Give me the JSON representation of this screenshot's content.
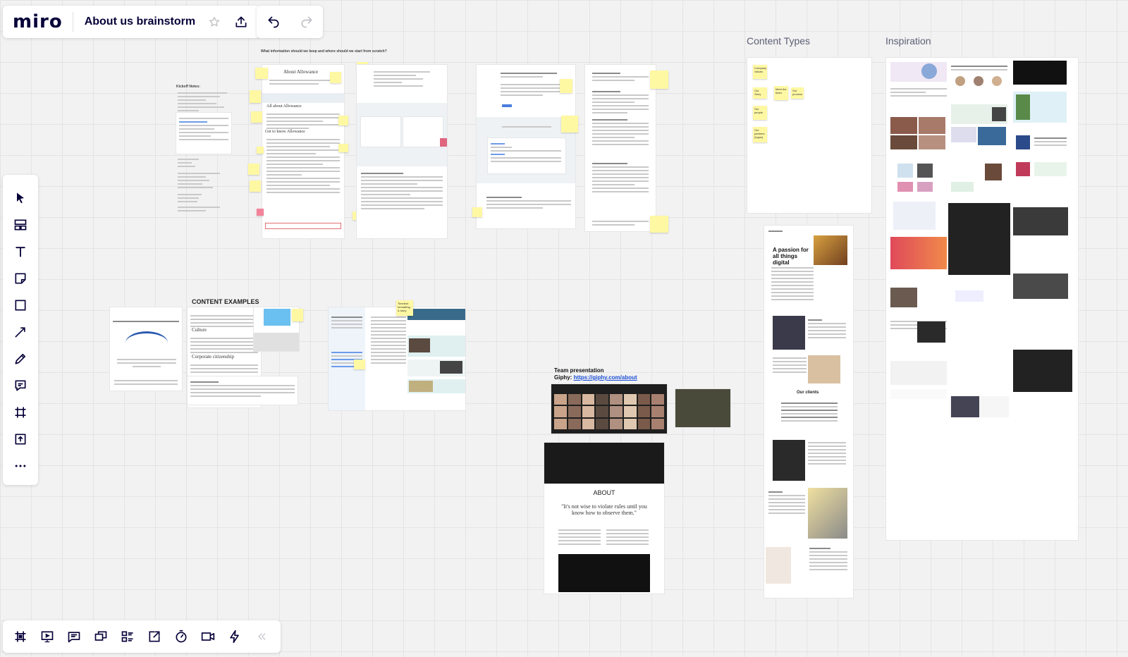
{
  "app": {
    "logo": "miro",
    "board_title": "About us brainstorm"
  },
  "topbar": {
    "star_icon": "star-icon",
    "share_icon": "upload-icon",
    "undo_icon": "undo-icon",
    "redo_icon": "redo-icon"
  },
  "left_toolbar": {
    "tools": [
      "select-icon",
      "templates-icon",
      "text-icon",
      "sticky-note-icon",
      "shape-icon",
      "connection-line-icon",
      "pen-icon",
      "comment-icon",
      "frame-icon",
      "upload-icon",
      "more-icon"
    ]
  },
  "bottom_toolbar": {
    "tools": [
      "frames-icon",
      "presentation-icon",
      "comments-icon",
      "screen-share-icon",
      "cards-icon",
      "export-icon",
      "timer-icon",
      "video-icon",
      "lightning-icon",
      "collapse-icon"
    ]
  },
  "board": {
    "top_question": "What information should we keep and where should we start from scratch?",
    "kickoff_notes": "Kickoff Notes:",
    "about_allowance": "About Allowance",
    "all_about": "All about Allowance",
    "get_to_know": "Get to know Allowance",
    "content_types_label": "Content Types",
    "inspiration_label": "Inspiration",
    "content_examples": "CONTENT EXAMPLES",
    "culture": "Culture",
    "corporate": "Corporate citizenship",
    "timeline_sticky": "Timeline: formatting & story",
    "team_presentation": "Team presentation",
    "giphy_prefix": "Giphy:",
    "giphy_link": "https://giphy.com/about",
    "about_heading": "ABOUT",
    "about_quote": "\"It's not wise to violate rules until you know how to observe them.\"",
    "passion_heading": "A passion for all things digital",
    "our_clients": "Our clients",
    "content_type_stickies": [
      "Company Values",
      "Our Story",
      "Meet the team",
      "Our process",
      "Our people",
      "Our partners (logos)"
    ]
  },
  "colors": {
    "sticky": "#fff8a3",
    "sticky_red": "#f4839a",
    "brand": "#050038",
    "link": "#1a4fd6"
  }
}
